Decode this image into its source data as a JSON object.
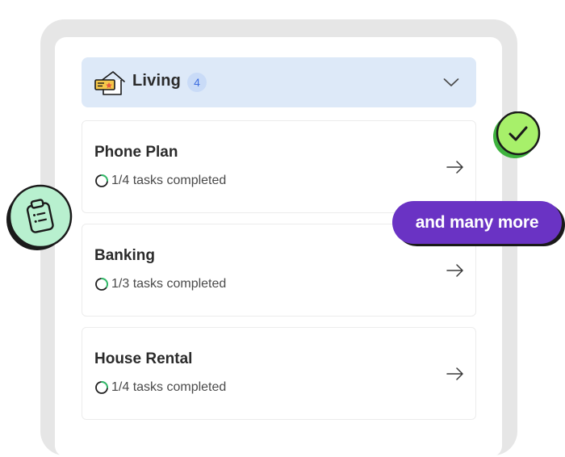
{
  "category": {
    "icon": "house-icon",
    "title": "Living",
    "count": "4",
    "expand_icon": "chevron-down-icon"
  },
  "tasks": [
    {
      "title": "Phone Plan",
      "progress_text": "1/4 tasks completed",
      "completed": 1,
      "total": 4,
      "action_icon": "arrow-right-icon"
    },
    {
      "title": "Banking",
      "progress_text": "1/3 tasks completed",
      "completed": 1,
      "total": 3,
      "action_icon": "arrow-right-icon"
    },
    {
      "title": "House Rental",
      "progress_text": "1/4 tasks completed",
      "completed": 1,
      "total": 4,
      "action_icon": "arrow-right-icon"
    }
  ],
  "badges": {
    "check_icon": "checkmark-icon",
    "clipboard_icon": "clipboard-icon",
    "pill_text": "and many more"
  },
  "colors": {
    "header_bg": "#dde9f8",
    "badge_bg": "#c9dbf7",
    "badge_text": "#3f6ee0",
    "progress_green": "#2fc06a",
    "accent_green": "#a7f06a",
    "mint_green": "#b8f0cf",
    "pill_purple": "#6a33c4",
    "frame_gray": "#e6e6e6"
  }
}
